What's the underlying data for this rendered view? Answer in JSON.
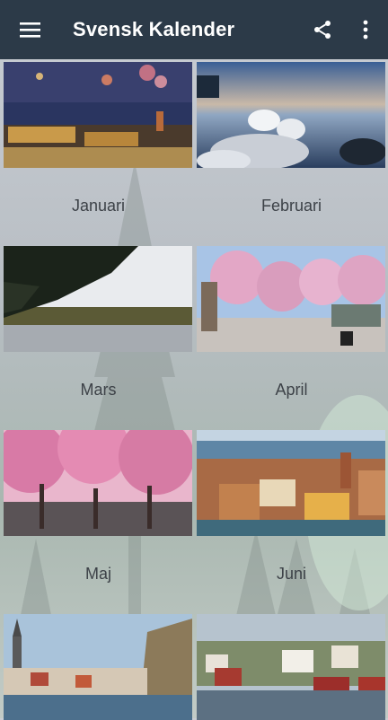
{
  "app": {
    "title": "Svensk Kalender"
  },
  "toolbar": {
    "menu_icon": "hamburger-menu-icon",
    "share_icon": "share-icon",
    "more_icon": "more-vert-icon"
  },
  "months": [
    {
      "label": "Januari"
    },
    {
      "label": "Februari"
    },
    {
      "label": "Mars"
    },
    {
      "label": "April"
    },
    {
      "label": "Maj"
    },
    {
      "label": "Juni"
    },
    {
      "label": ""
    },
    {
      "label": ""
    }
  ],
  "colors": {
    "appbar": "#2c3a48",
    "label_text": "#3d4248"
  }
}
